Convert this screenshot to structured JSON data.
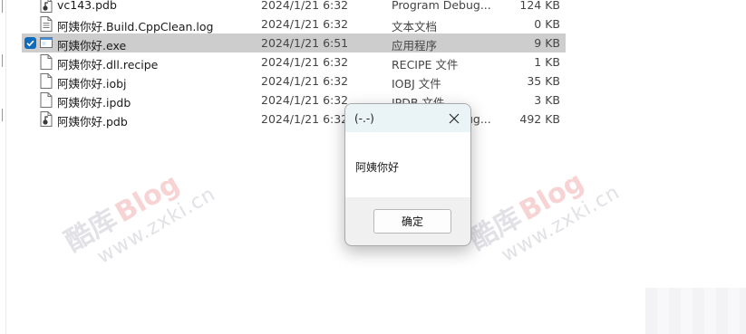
{
  "files": [
    {
      "name": "vc143.pdb",
      "date": "2024/1/21 6:32",
      "type": "Program Debug...",
      "size": "124 KB",
      "icon": "pdb-file-icon",
      "selected": false
    },
    {
      "name": "阿姨你好.Build.CppClean.log",
      "date": "2024/1/21 6:32",
      "type": "文本文档",
      "size": "0 KB",
      "icon": "text-file-icon",
      "selected": false
    },
    {
      "name": "阿姨你好.exe",
      "date": "2024/1/21 6:51",
      "type": "应用程序",
      "size": "9 KB",
      "icon": "exe-file-icon",
      "selected": true
    },
    {
      "name": "阿姨你好.dll.recipe",
      "date": "2024/1/21 6:32",
      "type": "RECIPE 文件",
      "size": "1 KB",
      "icon": "blank-file-icon",
      "selected": false
    },
    {
      "name": "阿姨你好.iobj",
      "date": "2024/1/21 6:32",
      "type": "IOBJ 文件",
      "size": "35 KB",
      "icon": "blank-file-icon",
      "selected": false
    },
    {
      "name": "阿姨你好.ipdb",
      "date": "2024/1/21 6:32",
      "type": "IPDB 文件",
      "size": "3 KB",
      "icon": "blank-file-icon",
      "selected": false
    },
    {
      "name": "阿姨你好.pdb",
      "date": "2024/1/21 6:32",
      "type": "Program Debug...",
      "size": "492 KB",
      "icon": "pdb-file-icon",
      "selected": false
    }
  ],
  "dialog": {
    "title": "(-.-)",
    "message": "阿姨你好",
    "ok_label": "确定",
    "close_icon": "close-icon"
  },
  "watermark": {
    "brand_cn": "酷库",
    "brand_blog": "Blog",
    "url": "www.zxki.cn"
  },
  "colors": {
    "selection": "#cdcdcd",
    "checkbox": "#0f6cbd",
    "dialog_titlebar": "#eaf4f7"
  }
}
